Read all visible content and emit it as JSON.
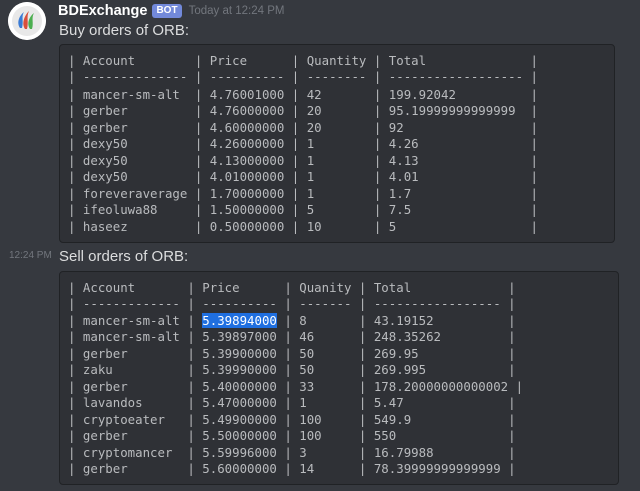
{
  "message": {
    "author": "BDExchange",
    "bot_tag": "BOT",
    "timestamp": "Today at 12:24 PM",
    "side_timestamp": "12:24 PM"
  },
  "buy": {
    "title": "Buy orders of ORB:",
    "header": "| Account        | Price      | Quantity | Total              |",
    "separator": "| -------------- | ---------- | -------- | ------------------ |",
    "rows": [
      "| mancer-sm-alt  | 4.76001000 | 42       | 199.92042          |",
      "| gerber         | 4.76000000 | 20       | 95.19999999999999  |",
      "| gerber         | 4.60000000 | 20       | 92                 |",
      "| dexy50         | 4.26000000 | 1        | 4.26               |",
      "| dexy50         | 4.13000000 | 1        | 4.13               |",
      "| dexy50         | 4.01000000 | 1        | 4.01               |",
      "| foreveraverage | 1.70000000 | 1        | 1.7                |",
      "| ifeoluwa88     | 1.50000000 | 5        | 7.5                |",
      "| haseez         | 0.50000000 | 10       | 5                  |"
    ]
  },
  "sell": {
    "title": "Sell orders of ORB:",
    "header": "| Account       | Price      | Quanity | Total             |",
    "separator": "| ------------- | ---------- | ------- | ----------------- |",
    "first_row_prefix": "| mancer-sm-alt | ",
    "first_row_selected": "5.39894000",
    "first_row_suffix": " | 8       | 43.19152          |",
    "rows": [
      "| mancer-sm-alt | 5.39897000 | 46      | 248.35262         |",
      "| gerber        | 5.39900000 | 50      | 269.95            |",
      "| zaku          | 5.39990000 | 50      | 269.995           |",
      "| gerber        | 5.40000000 | 33      | 178.20000000000002 |",
      "| lavandos      | 5.47000000 | 1       | 5.47              |",
      "| cryptoeater   | 5.49900000 | 100     | 549.9             |",
      "| gerber        | 5.50000000 | 100     | 550               |",
      "| cryptomancer  | 5.59996000 | 3       | 16.79988          |",
      "| gerber        | 5.60000000 | 14      | 78.39999999999999 |"
    ]
  },
  "colors": {
    "background": "#36393f",
    "codeblock": "#2f3136",
    "bot_tag": "#7289da",
    "selection": "#1f6fe0"
  },
  "icons": {
    "avatar": "steem-logo-icon"
  }
}
